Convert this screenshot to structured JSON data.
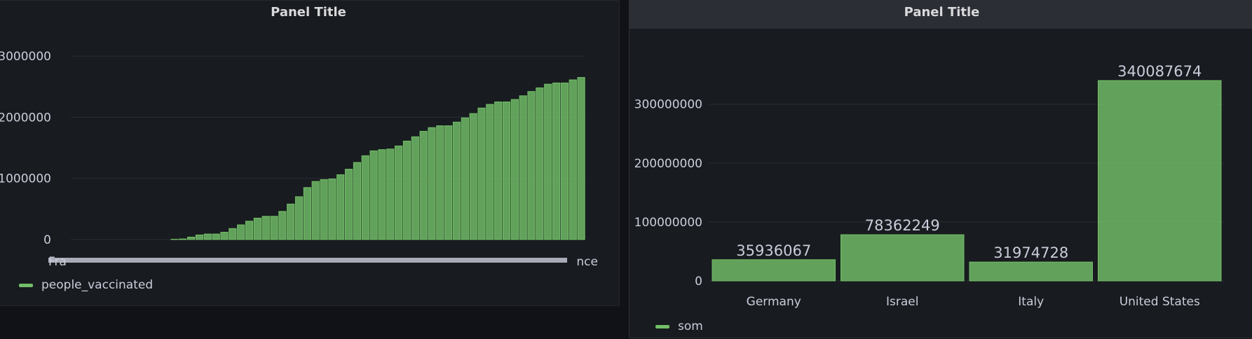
{
  "panels": {
    "left": {
      "title": "Panel Title"
    },
    "right": {
      "title": "Panel Title"
    }
  },
  "chart_data": [
    {
      "type": "bar",
      "title": "Panel Title",
      "series": [
        {
          "name": "people_vaccinated",
          "color": "#73bf69",
          "values": [
            0,
            0,
            0,
            0,
            0,
            0,
            0,
            0,
            0,
            0,
            0,
            0,
            5000,
            10000,
            40000,
            75000,
            90000,
            90000,
            120000,
            180000,
            240000,
            300000,
            350000,
            380000,
            380000,
            460000,
            580000,
            700000,
            850000,
            950000,
            980000,
            990000,
            1060000,
            1150000,
            1260000,
            1370000,
            1450000,
            1470000,
            1480000,
            1530000,
            1610000,
            1680000,
            1770000,
            1830000,
            1860000,
            1860000,
            1920000,
            1990000,
            2060000,
            2150000,
            2210000,
            2250000,
            2250000,
            2290000,
            2350000,
            2420000,
            2480000,
            2540000,
            2560000,
            2560000,
            2610000,
            2650000
          ]
        }
      ],
      "x_tick_first": "Fra",
      "x_tick_last": "nce",
      "y_ticks": [
        "0",
        "1000000",
        "2000000",
        "3000000"
      ],
      "ylim": [
        0,
        3000000
      ],
      "grid": true,
      "legend_position": "bottom-left"
    },
    {
      "type": "bar",
      "title": "Panel Title",
      "categories": [
        "Germany",
        "Israel",
        "Italy",
        "United States"
      ],
      "series": [
        {
          "name": "som",
          "color": "#73bf69",
          "values": [
            35936067,
            78362249,
            31974728,
            340087674
          ]
        }
      ],
      "y_ticks": [
        "0",
        "100000000",
        "200000000",
        "300000000"
      ],
      "ylim": [
        0,
        340087674
      ],
      "grid": true,
      "show_values": true,
      "legend_position": "bottom-left"
    }
  ]
}
